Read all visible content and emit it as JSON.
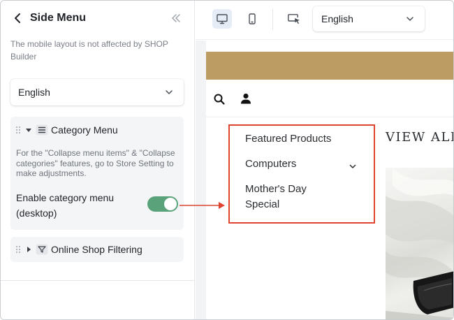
{
  "sidebar": {
    "title": "Side Menu",
    "note": "The mobile layout is not affected by SHOP Builder",
    "language_select": {
      "value": "English"
    },
    "category_menu": {
      "title": "Category Menu",
      "note": "For the \"Collapse menu items\" & \"Collapse categories\" features, go to Store Setting to make adjustments.",
      "toggle_label": "Enable category menu (desktop)",
      "toggle_on": true
    },
    "filtering": {
      "title": "Online Shop Filtering"
    }
  },
  "toolbar": {
    "language_select": {
      "value": "English"
    },
    "active_device": "desktop"
  },
  "preview": {
    "menu_items": [
      {
        "label": "Featured Products",
        "has_children": false
      },
      {
        "label": "Computers",
        "has_children": true
      },
      {
        "label": "Mother's Day Special",
        "has_children": false
      }
    ],
    "view_all": "VIEW ALL",
    "announcement_color": "#bc9c63"
  },
  "colors": {
    "toggle_on": "#5aa37a",
    "highlight": "#e0432f",
    "active_tool": "#e6ecf5"
  },
  "icons": [
    "back-arrow-icon",
    "collapse-double-chevron-icon",
    "chevron-down-icon",
    "drag-handle-icon",
    "hamburger-menu-icon",
    "filter-icon",
    "desktop-icon",
    "mobile-icon",
    "cursor-select-icon",
    "search-icon",
    "user-icon",
    "arrow-right-icon"
  ]
}
